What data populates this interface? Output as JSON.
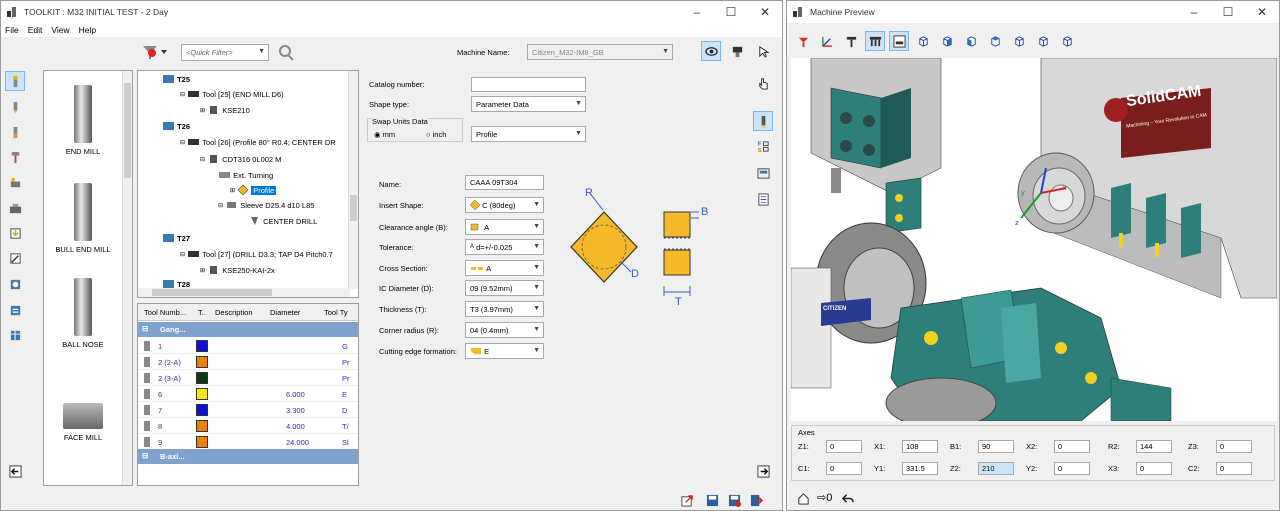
{
  "toolkit": {
    "title": "TOOLKIT : M32 INITIAL TEST - 2 Day",
    "menu": [
      "File",
      "Edit",
      "View",
      "Help"
    ],
    "quick_filter_placeholder": "<Quick Filter>",
    "machine_name_label": "Machine Name:",
    "machine_name_value": "Citizen_M32-IM8_GB",
    "library": [
      "END MILL",
      "BULL END MILL",
      "BALL NOSE",
      "FACE MILL"
    ],
    "tree": {
      "t25": "T25",
      "t25_tool": "Tool [25] (END MILL D6)",
      "t25_holder": "KSE210",
      "t26": "T26",
      "t26_tool": "Tool [26] (Profile 80° R0.4; CENTER DR",
      "t26_holder": "CDT316 0L002 M",
      "t26_ext": "Ext. Turning",
      "t26_profile": "Profile",
      "t26_sleeve": "Sleeve D25.4 d10 L85",
      "t26_center": "CENTER DRILL",
      "t27": "T27",
      "t27_tool": "Tool [27] (DRILL D3.3; TAP D4 Pitch0.7",
      "t27_holder": "KSE250-KAI-2x",
      "t28": "T28"
    },
    "table": {
      "headers": [
        "Tool Numb...",
        "T..",
        "Description",
        "Diameter",
        "Tool Ty"
      ],
      "group1": "Gang...",
      "rows": [
        {
          "num": "1",
          "color": "#1010d0",
          "diameter": "",
          "type": "G"
        },
        {
          "num": "2 (2-A)",
          "color": "#e8820c",
          "diameter": "",
          "type": "Pr"
        },
        {
          "num": "2 (3-A)",
          "color": "#0b3a14",
          "diameter": "",
          "type": "Pr"
        },
        {
          "num": "6",
          "color": "#f0ea10",
          "diameter": "6.000",
          "type": "E"
        },
        {
          "num": "7",
          "color": "#1010d0",
          "diameter": "3.300",
          "type": "D"
        },
        {
          "num": "8",
          "color": "#e8820c",
          "diameter": "4.000",
          "type": "T/"
        },
        {
          "num": "9",
          "color": "#e8820c",
          "diameter": "24.000",
          "type": "Sl"
        }
      ],
      "group2": "B-axi..."
    },
    "form": {
      "catalog_label": "Catalog number:",
      "catalog_value": "",
      "shape_type_label": "Shape type:",
      "shape_type_value": "Parameter Data",
      "swap_units_label": "Swap Units Data",
      "mm": "mm",
      "inch": "inch",
      "profile_value": "Profile",
      "name_label": "Name:",
      "name_value": "CAAA 09T304",
      "insert_shape_label": "Insert Shape:",
      "insert_shape_value": "C (80deg)",
      "clearance_label": "Clearance angle (B):",
      "clearance_value": "A",
      "tolerance_label": "Tolerance:",
      "tolerance_value": "d=+/-0.025",
      "cross_label": "Cross Section:",
      "cross_value": "A",
      "ic_label": "IC Diameter (D):",
      "ic_value": "09 (9.52mm)",
      "thickness_label": "Thickness (T):",
      "thickness_value": "T3 (3.97mm)",
      "corner_label": "Corner radius (R):",
      "corner_value": "04 (0.4mm)",
      "cutting_label": "Cutting edge formation:",
      "cutting_value": "E",
      "diag_r": "R",
      "diag_d": "D",
      "diag_b": "B",
      "diag_t": "T",
      "diag_tol_prefix": "A"
    }
  },
  "preview": {
    "title": "Machine Preview",
    "brand": "SolidCAM",
    "brand_sub": "Machining – Your Revolution in CAM",
    "axes_label": "Axes",
    "axes": [
      {
        "label": "Z1:",
        "value": "0"
      },
      {
        "label": "X1:",
        "value": "108"
      },
      {
        "label": "B1:",
        "value": "90"
      },
      {
        "label": "X2:",
        "value": "0"
      },
      {
        "label": "R2:",
        "value": "144"
      },
      {
        "label": "Z3:",
        "value": "0"
      },
      {
        "label": "C1:",
        "value": "0"
      },
      {
        "label": "Y1:",
        "value": "331.5"
      },
      {
        "label": "Z2:",
        "value": "210"
      },
      {
        "label": "Y2:",
        "value": "0"
      },
      {
        "label": "X3:",
        "value": "0"
      },
      {
        "label": "C2:",
        "value": "0"
      }
    ],
    "zero_label": "⇨0",
    "axis_x": "x",
    "axis_y": "y",
    "axis_z": "z",
    "citizen": "CITIZEN"
  },
  "colors": {
    "accent": "#0078d7",
    "group_header": "#7fa3cc",
    "machine_teal": "#2e7f7a",
    "insert_yellow": "#f5b92a"
  }
}
